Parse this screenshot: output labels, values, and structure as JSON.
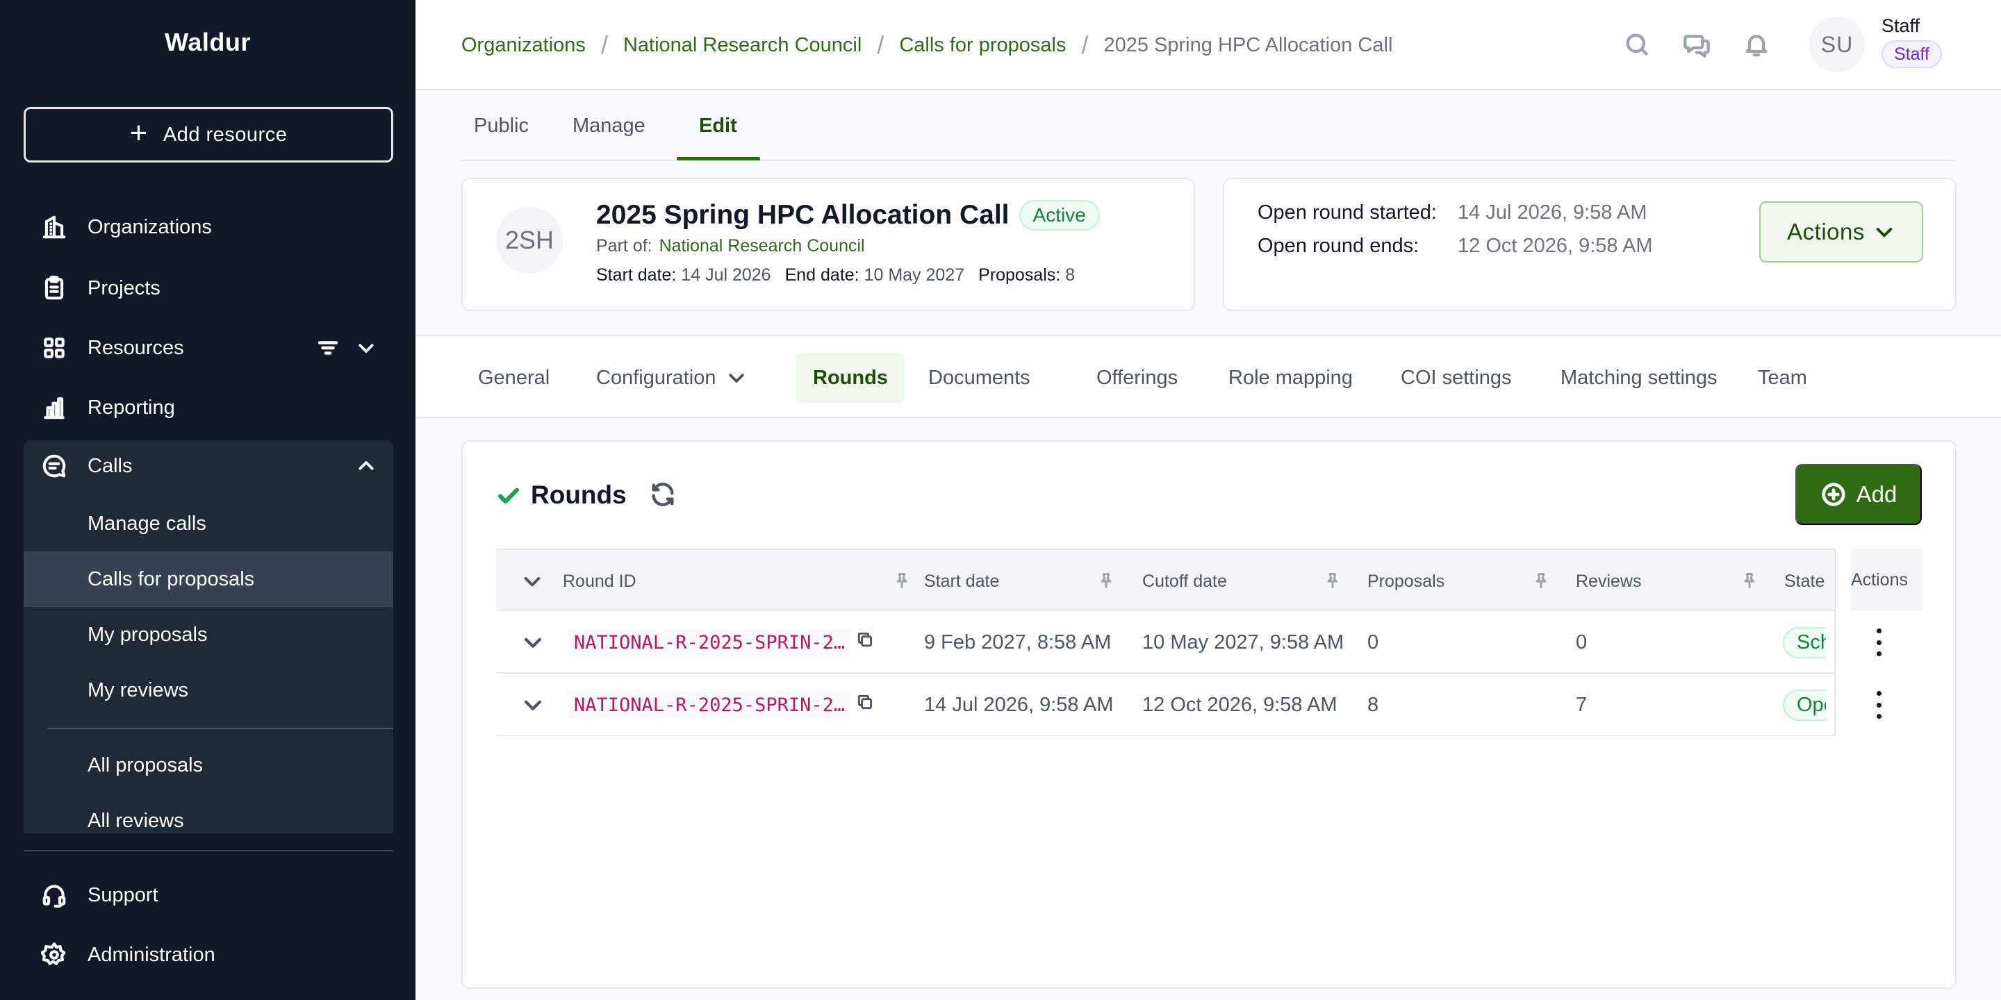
{
  "sidebar": {
    "brand": "Waldur",
    "add_resource": "Add resource",
    "items": [
      {
        "label": "Organizations",
        "icon": "building-icon"
      },
      {
        "label": "Projects",
        "icon": "clipboard-icon"
      },
      {
        "label": "Resources",
        "icon": "grid-icon"
      },
      {
        "label": "Reporting",
        "icon": "bar-chart-icon"
      },
      {
        "label": "Calls",
        "icon": "chat-icon"
      }
    ],
    "calls_sub": [
      "Manage calls",
      "Calls for proposals",
      "My proposals",
      "My reviews",
      "All proposals",
      "All reviews"
    ],
    "bottom": [
      {
        "label": "Support",
        "icon": "headset-icon"
      },
      {
        "label": "Administration",
        "icon": "gear-icon"
      }
    ]
  },
  "header": {
    "breadcrumb": [
      "Organizations",
      "National Research Council",
      "Calls for proposals",
      "2025 Spring HPC Allocation Call"
    ],
    "separator": "/",
    "avatar_initials": "SU",
    "user_name": "Staff",
    "user_badge": "Staff"
  },
  "top_tabs": [
    "Public",
    "Manage",
    "Edit"
  ],
  "call": {
    "avatar": "2SH",
    "title": "2025 Spring HPC Allocation Call",
    "status": "Active",
    "part_of_label": "Part of:",
    "part_of": "National Research Council",
    "start_label": "Start date:",
    "start": "14 Jul 2026",
    "end_label": "End date:",
    "end": "10 May 2027",
    "proposals_label": "Proposals:",
    "proposals": "8"
  },
  "round_info": {
    "started_label": "Open round started:",
    "started": "14 Jul 2026, 9:58 AM",
    "ends_label": "Open round ends:",
    "ends": "12 Oct 2026, 9:58 AM",
    "actions": "Actions"
  },
  "section_tabs": [
    "General",
    "Configuration",
    "Rounds",
    "Documents",
    "Offerings",
    "Role mapping",
    "COI settings",
    "Matching settings",
    "Team"
  ],
  "rounds": {
    "title": "Rounds",
    "add": "Add",
    "columns": [
      "Round ID",
      "Start date",
      "Cutoff date",
      "Proposals",
      "Reviews",
      "State",
      "Actions"
    ],
    "rows": [
      {
        "id": "NATIONAL-R-2025-SPRIN-2…",
        "start": "9 Feb 2027, 8:58 AM",
        "cutoff": "10 May 2027, 9:58 AM",
        "proposals": "0",
        "reviews": "0",
        "state": "Sche"
      },
      {
        "id": "NATIONAL-R-2025-SPRIN-2…",
        "start": "14 Jul 2026, 9:58 AM",
        "cutoff": "12 Oct 2026, 9:58 AM",
        "proposals": "8",
        "reviews": "7",
        "state": "Ope"
      }
    ]
  },
  "colors": {
    "sidebar_bg": "#111827",
    "accent_green": "#2f6b13",
    "status_green": "#15803d",
    "round_id_pink": "#be185d"
  }
}
